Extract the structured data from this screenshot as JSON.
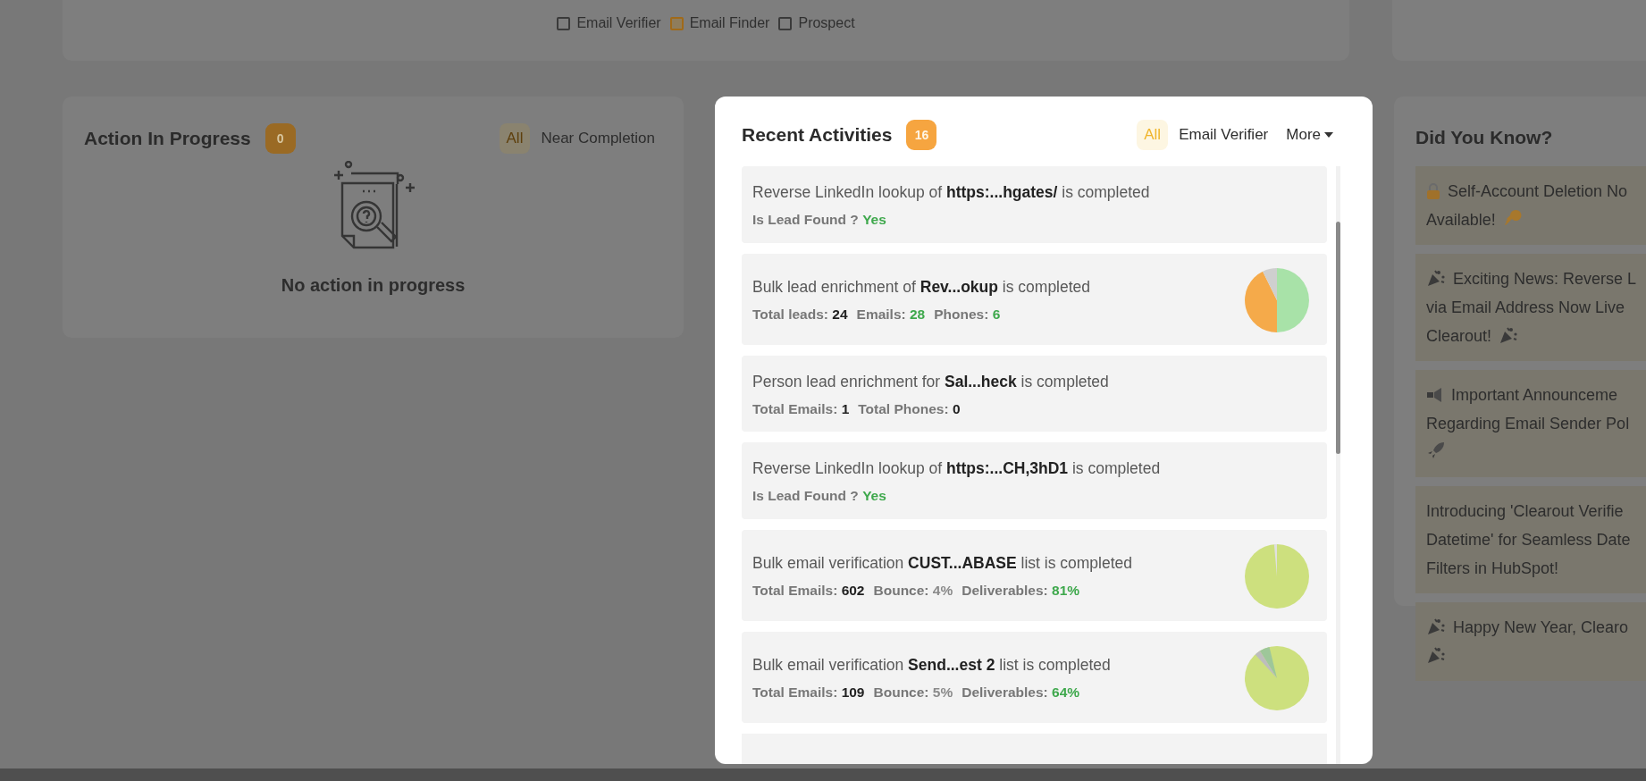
{
  "top_filters": [
    {
      "label": "Email Verifier",
      "checked": false
    },
    {
      "label": "Email Finder",
      "checked": true
    },
    {
      "label": "Prospect",
      "checked": false
    }
  ],
  "action_panel": {
    "title": "Action In Progress",
    "count": "0",
    "tabs": [
      {
        "label": "All",
        "selected": true
      },
      {
        "label": "Near Completion",
        "selected": false
      }
    ],
    "empty_text": "No action in progress"
  },
  "activity_panel": {
    "title": "Recent Activities",
    "count": "16",
    "tabs": [
      {
        "label": "All",
        "selected": true
      },
      {
        "label": "Email Verifier",
        "selected": false
      }
    ],
    "more": {
      "label": "More"
    },
    "items": [
      {
        "text": "Reverse LinkedIn lookup of **https:...hgates/** is completed",
        "kind": "lookup",
        "stats": [
          {
            "label": "Is Lead Found ?",
            "value": "Yes",
            "kind": "good"
          }
        ]
      },
      {
        "text": "Bulk lead enrichment of **Rev...okup** is completed",
        "kind": "leads",
        "stats": [
          {
            "label": "Total leads:",
            "value": "24",
            "kind": "strong"
          },
          {
            "label": "Emails:",
            "value": "28",
            "kind": "good"
          },
          {
            "label": "Phones:",
            "value": "6",
            "kind": "good"
          }
        ]
      },
      {
        "text": "Person lead enrichment for **Sal...heck** is completed",
        "kind": "person",
        "stats": [
          {
            "label": "Total Emails:",
            "value": "1",
            "kind": "strong"
          },
          {
            "label": "Total Phones:",
            "value": "0",
            "kind": "strong"
          }
        ]
      },
      {
        "text": "Reverse LinkedIn lookup of **https:...CH,3hD1** is completed",
        "kind": "lookup",
        "stats": [
          {
            "label": "Is Lead Found ?",
            "value": "Yes",
            "kind": "good"
          }
        ]
      },
      {
        "text": "Bulk email verification **CUST...ABASE** list is completed",
        "kind": "verify",
        "stats": [
          {
            "label": "Total Emails:",
            "value": "602",
            "kind": "strong"
          },
          {
            "label": "Bounce:",
            "value": "4%",
            "kind": "plain"
          },
          {
            "label": "Deliverables:",
            "value": "81%",
            "kind": "good"
          }
        ]
      },
      {
        "text": "Bulk email verification **Send...est 2** list is completed",
        "kind": "verify2",
        "stats": [
          {
            "label": "Total Emails:",
            "value": "109",
            "kind": "strong"
          },
          {
            "label": "Bounce:",
            "value": "5%",
            "kind": "plain"
          },
          {
            "label": "Deliverables:",
            "value": "64%",
            "kind": "good"
          }
        ]
      }
    ]
  },
  "tips_panel": {
    "title": "Did You Know?",
    "items": [
      {
        "kind": "deletion",
        "lines": [
          "Self-Account Deletion No",
          "Available!"
        ]
      },
      {
        "kind": "news",
        "lines": [
          "Exciting News: Reverse L",
          "via Email Address Now Live",
          "Clearout!"
        ]
      },
      {
        "kind": "announcement",
        "lines": [
          "Important Announceme",
          "Regarding Email Sender Pol"
        ]
      },
      {
        "kind": "plain",
        "lines": [
          "Introducing 'Clearout Verifie",
          "Datetime' for Seamless Date",
          "Filters in HubSpot!"
        ]
      },
      {
        "kind": "greeting",
        "lines": [
          "Happy New Year, Clearo"
        ]
      }
    ]
  }
}
